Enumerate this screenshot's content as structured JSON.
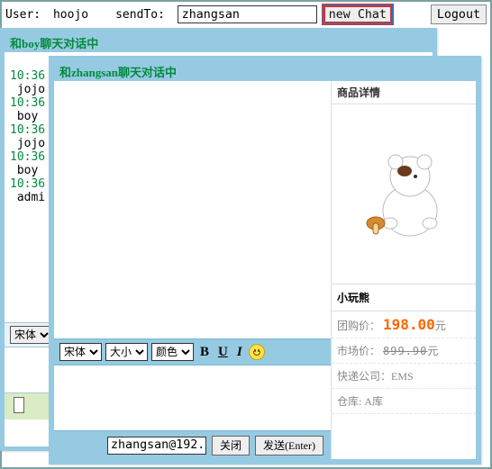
{
  "topbar": {
    "user_label": "User: ",
    "user_value": "hoojo",
    "sendto_label": "sendTo: ",
    "sendto_value": "zhangsan",
    "newchat_label": "new Chat",
    "logout_label": "Logout"
  },
  "win_boy": {
    "title": "和boy聊天对话中",
    "lines": [
      {
        "ts": "10:36",
        "name": "jojo"
      },
      {
        "ts": "10:36",
        "name": "boy"
      },
      {
        "ts": "10:36",
        "name": "jojo"
      },
      {
        "ts": "10:36",
        "name": "boy"
      },
      {
        "ts": "10:36",
        "name": "admi"
      }
    ],
    "font_sel": "宋体"
  },
  "win_zh": {
    "title": "和zhangsan聊天对话中",
    "toolbar": {
      "font_sel": "宋体",
      "size_sel": "大小",
      "color_sel": "颜色",
      "b": "B",
      "u": "U",
      "i": "I"
    },
    "footer": {
      "target_value": "zhangsan@192.",
      "close_label": "关闭",
      "send_label": "发送(Enter)"
    }
  },
  "product": {
    "header": "商品详情",
    "name": "小玩熊",
    "group_label": "团购价：",
    "group_price": "198.00",
    "group_unit": "元",
    "market_label": "市场价：",
    "market_price": "899.90",
    "market_unit": "元",
    "courier_label": "快递公司：",
    "courier_value": "EMS",
    "stock_label": "仓库: ",
    "stock_value": "A库"
  }
}
